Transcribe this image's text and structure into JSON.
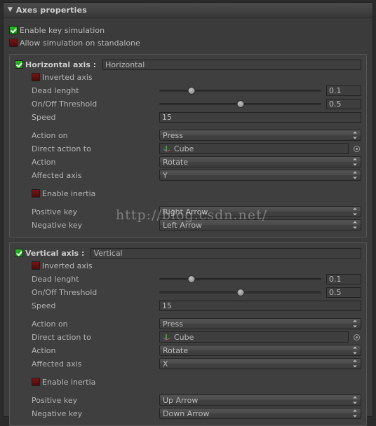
{
  "panel": {
    "title": "Axes properties",
    "foldout_icon": "triangle-down-icon",
    "expanded": true
  },
  "global_toggles": [
    {
      "label": "Enable key simulation",
      "checked": true
    },
    {
      "label": "Allow simulation on standalone",
      "checked": false
    }
  ],
  "labels": {
    "inverted_axis": "Inverted axis",
    "dead_lenght": "Dead lenght",
    "on_off_threshold": "On/Off Threshold",
    "speed": "Speed",
    "action_on": "Action on",
    "direct_action_to": "Direct action to",
    "action": "Action",
    "affected_axis": "Affected axis",
    "enable_inertia": "Enable inertia",
    "positive_key": "Positive key",
    "negative_key": "Negative key"
  },
  "icons": {
    "object_gizmo": "gameobject-axis-gizmo-icon",
    "object_picker": "object-picker-target-icon",
    "dropdown_arrows": "updown-arrows-icon",
    "checkmark": "checkmark-icon"
  },
  "axes": [
    {
      "id": "horizontal",
      "enabled": true,
      "title": "Horizontal axis :",
      "name_value": "Horizontal",
      "inverted_axis": false,
      "dead_lenght": "0.1",
      "dead_lenght_pct": 20,
      "on_off_threshold": "0.5",
      "on_off_threshold_pct": 50,
      "speed": "15",
      "action_on": "Press",
      "direct_action_to": "Cube",
      "action": "Rotate",
      "affected_axis": "Y",
      "enable_inertia": false,
      "positive_key": "Right Arrow",
      "negative_key": "Left Arrow"
    },
    {
      "id": "vertical",
      "enabled": true,
      "title": "Vertical axis :",
      "name_value": "Vertical",
      "inverted_axis": false,
      "dead_lenght": "0.1",
      "dead_lenght_pct": 20,
      "on_off_threshold": "0.5",
      "on_off_threshold_pct": 50,
      "speed": "15",
      "action_on": "Press",
      "direct_action_to": "Cube",
      "action": "Rotate",
      "affected_axis": "X",
      "enable_inertia": false,
      "positive_key": "Up Arrow",
      "negative_key": "Down Arrow"
    }
  ],
  "watermark": "http://blog.csdn.net/",
  "colors": {
    "panel_bg": "#3b3b3b",
    "group_bg": "#3f3f3f",
    "group_border": "#555555",
    "text": "#b4b4b4",
    "toggle_on": "#2fbf2a",
    "toggle_off": "#7a1414",
    "field_bg": "#3e3e3e"
  }
}
